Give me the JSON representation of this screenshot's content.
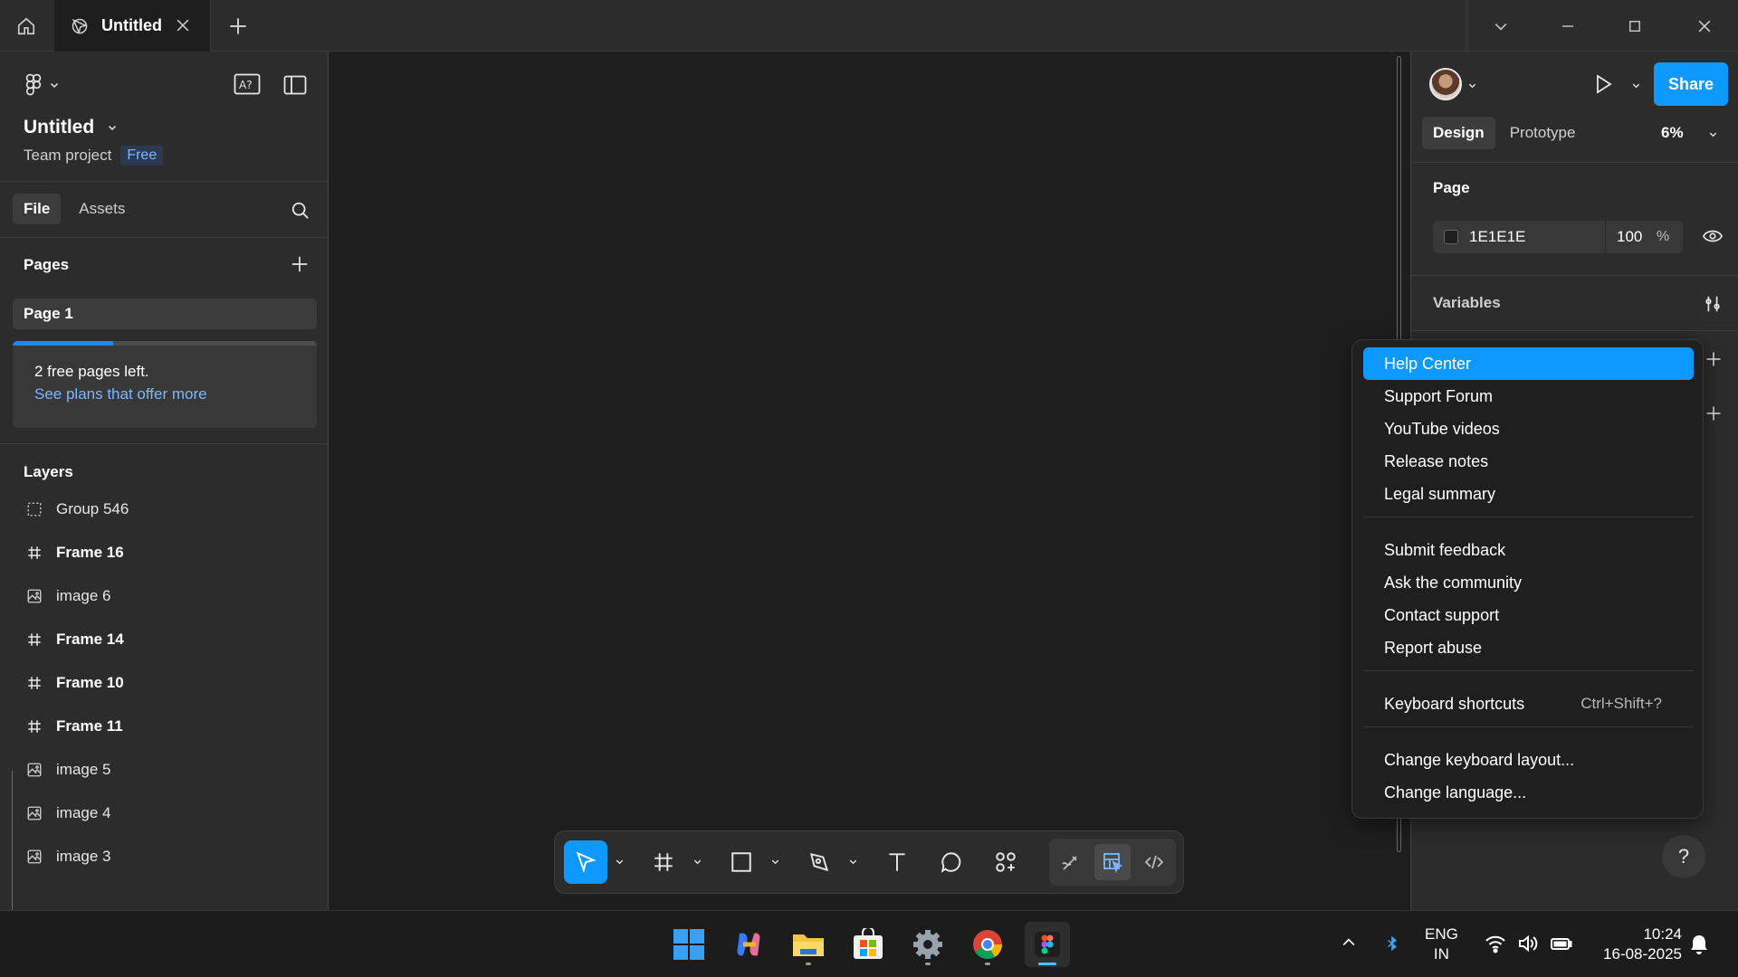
{
  "window": {
    "tab_title": "Untitled"
  },
  "left_panel": {
    "file_name": "Untitled",
    "team": "Team project",
    "plan_badge": "Free",
    "tabs": [
      "File",
      "Assets"
    ],
    "pages_heading": "Pages",
    "pages": [
      "Page 1"
    ],
    "pages_used_fraction": 0.33,
    "notice_text": "2 free pages left.",
    "notice_link": "See plans that offer more",
    "layers_heading": "Layers",
    "layers": [
      {
        "name": "Group 546",
        "icon": "group-icon"
      },
      {
        "name": "Frame 16",
        "icon": "frame-icon"
      },
      {
        "name": "image 6",
        "icon": "image-icon"
      },
      {
        "name": "Frame 14",
        "icon": "frame-icon"
      },
      {
        "name": "Frame 10",
        "icon": "frame-icon"
      },
      {
        "name": "Frame 11",
        "icon": "frame-icon"
      },
      {
        "name": "image 5",
        "icon": "image-icon"
      },
      {
        "name": "image 4",
        "icon": "image-icon"
      },
      {
        "name": "image 3",
        "icon": "image-icon"
      }
    ]
  },
  "right_panel": {
    "share_label": "Share",
    "tabs": [
      "Design",
      "Prototype"
    ],
    "zoom": "6%",
    "page_heading": "Page",
    "page_color_hex": "1E1E1E",
    "page_opacity": "100",
    "opacity_unit": "%",
    "variables_heading": "Variables",
    "help_label": "?"
  },
  "help_menu": {
    "groups": [
      [
        "Help Center",
        "Support Forum",
        "YouTube videos",
        "Release notes",
        "Legal summary"
      ],
      [
        "Submit feedback",
        "Ask the community",
        "Contact support",
        "Report abuse"
      ],
      [
        "Keyboard shortcuts"
      ],
      [
        "Change keyboard layout...",
        "Change language..."
      ]
    ],
    "keyboard_shortcut_hint": "Ctrl+Shift+?",
    "highlighted": "Help Center"
  },
  "taskbar": {
    "language_line1": "ENG",
    "language_line2": "IN",
    "time": "10:24",
    "date": "16-08-2025"
  },
  "colors": {
    "accent": "#0d99ff",
    "panel": "#2c2c2c",
    "canvas": "#1e1e1e"
  }
}
